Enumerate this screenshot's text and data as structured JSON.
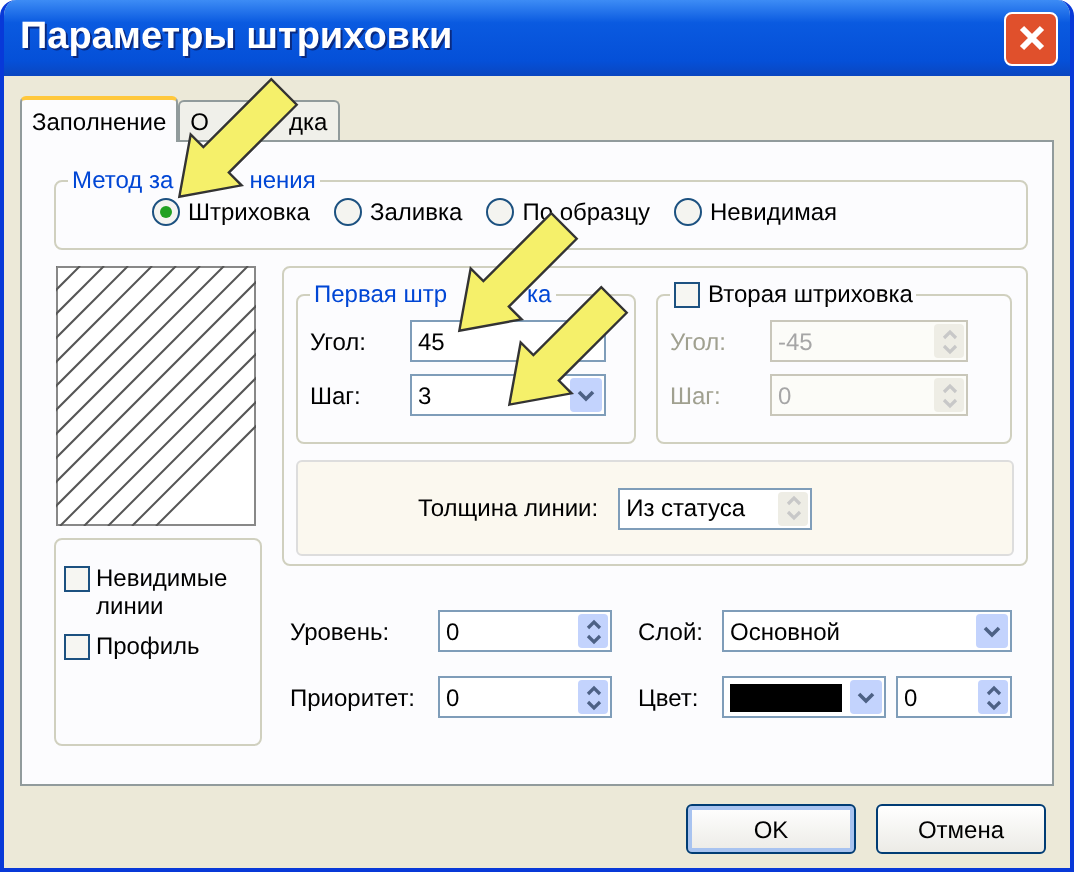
{
  "window": {
    "title": "Параметры штриховки"
  },
  "tabs": [
    {
      "label": "Заполнение",
      "selected": true
    },
    {
      "label_parts": [
        "О",
        "дка"
      ],
      "selected": false
    }
  ],
  "fill_method": {
    "title_parts": [
      "Метод за",
      "нения"
    ],
    "options": [
      {
        "label": "Штриховка",
        "selected": true
      },
      {
        "label": "Заливка",
        "selected": false
      },
      {
        "label": "По образцу",
        "selected": false
      },
      {
        "label": "Невидимая",
        "selected": false
      }
    ]
  },
  "first_hatch": {
    "title_parts": [
      "Первая штр",
      "ка"
    ],
    "fields": [
      {
        "label": "Угол:",
        "value": "45",
        "kind": "plain"
      },
      {
        "label": "Шаг:",
        "value": "3",
        "kind": "combo"
      }
    ]
  },
  "second_hatch": {
    "title": "Вторая штриховка",
    "checked": false,
    "disabled": true,
    "fields": [
      {
        "label": "Угол:",
        "value": "-45",
        "kind": "spin"
      },
      {
        "label": "Шаг:",
        "value": "0",
        "kind": "spin"
      }
    ]
  },
  "line_thickness": {
    "label": "Толщина линии:",
    "value": "Из статуса"
  },
  "options": [
    {
      "label": "Невидимые линии",
      "checked": false
    },
    {
      "label": "Профиль",
      "checked": false
    }
  ],
  "level": {
    "label": "Уровень:",
    "value": "0"
  },
  "priority": {
    "label": "Приоритет:",
    "value": "0"
  },
  "layer": {
    "label": "Слой:",
    "value": "Основной"
  },
  "color": {
    "label": "Цвет:",
    "color": "#000000",
    "value": "0"
  },
  "buttons": [
    {
      "label": "OK",
      "default": true
    },
    {
      "label": "Отмена",
      "default": false
    }
  ]
}
